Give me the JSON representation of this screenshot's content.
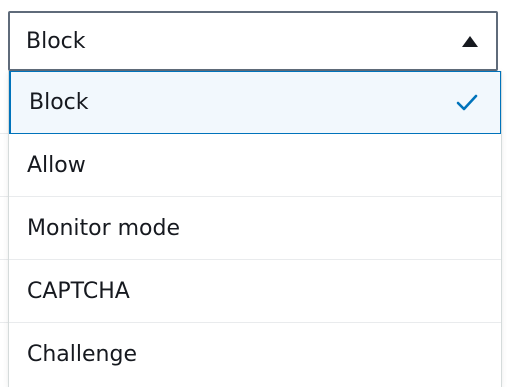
{
  "select": {
    "value": "Block",
    "caret_icon": "caret-up-icon",
    "border_color": "#5f6b7a"
  },
  "dropdown": {
    "options": [
      {
        "label": "Block",
        "selected": true,
        "icon": "check-icon"
      },
      {
        "label": "Allow",
        "selected": false
      },
      {
        "label": "Monitor mode",
        "selected": false
      },
      {
        "label": "CAPTCHA",
        "selected": false
      },
      {
        "label": "Challenge",
        "selected": false
      }
    ],
    "selected_bg": "#f2f8fd",
    "accent_color": "#0073bb"
  }
}
